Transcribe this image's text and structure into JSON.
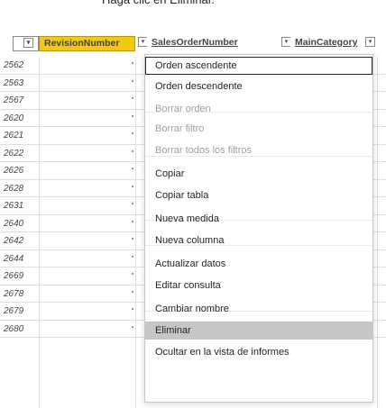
{
  "instruction": "Haga clic en Eliminar.",
  "columns": [
    {
      "label": "",
      "selected": false
    },
    {
      "label": "RevisionNumber",
      "selected": true
    },
    {
      "label": "SalesOrderNumber",
      "selected": false
    },
    {
      "label": "MainCategory",
      "selected": false
    }
  ],
  "dropdown_glyph": "▾",
  "rows": [
    "2562",
    "2563",
    "2567",
    "2620",
    "2621",
    "2622",
    "2626",
    "2628",
    "2631",
    "2640",
    "2642",
    "2644",
    "2669",
    "2678",
    "2679",
    "2680"
  ],
  "menu": [
    {
      "label": "Orden ascendente",
      "state": "focus"
    },
    {
      "label": "Orden descendente",
      "state": "normal"
    },
    {
      "label": "Borrar orden",
      "state": "disabled"
    },
    {
      "label": "Borrar filtro",
      "state": "disabled"
    },
    {
      "label": "Borrar todos los filtros",
      "state": "disabled"
    },
    {
      "label": "Copiar",
      "state": "normal"
    },
    {
      "label": "Copiar tabla",
      "state": "normal"
    },
    {
      "label": "Nueva medida",
      "state": "normal"
    },
    {
      "label": "Nueva columna",
      "state": "normal"
    },
    {
      "label": "Actualizar datos",
      "state": "normal"
    },
    {
      "label": "Editar consulta",
      "state": "normal"
    },
    {
      "label": "Cambiar nombre",
      "state": "normal"
    },
    {
      "label": "Eliminar",
      "state": "hover"
    },
    {
      "label": "Ocultar en la vista de informes",
      "state": "normal"
    }
  ],
  "colors": {
    "selected_header": "#f2c811",
    "hover": "#c8c6c4"
  }
}
